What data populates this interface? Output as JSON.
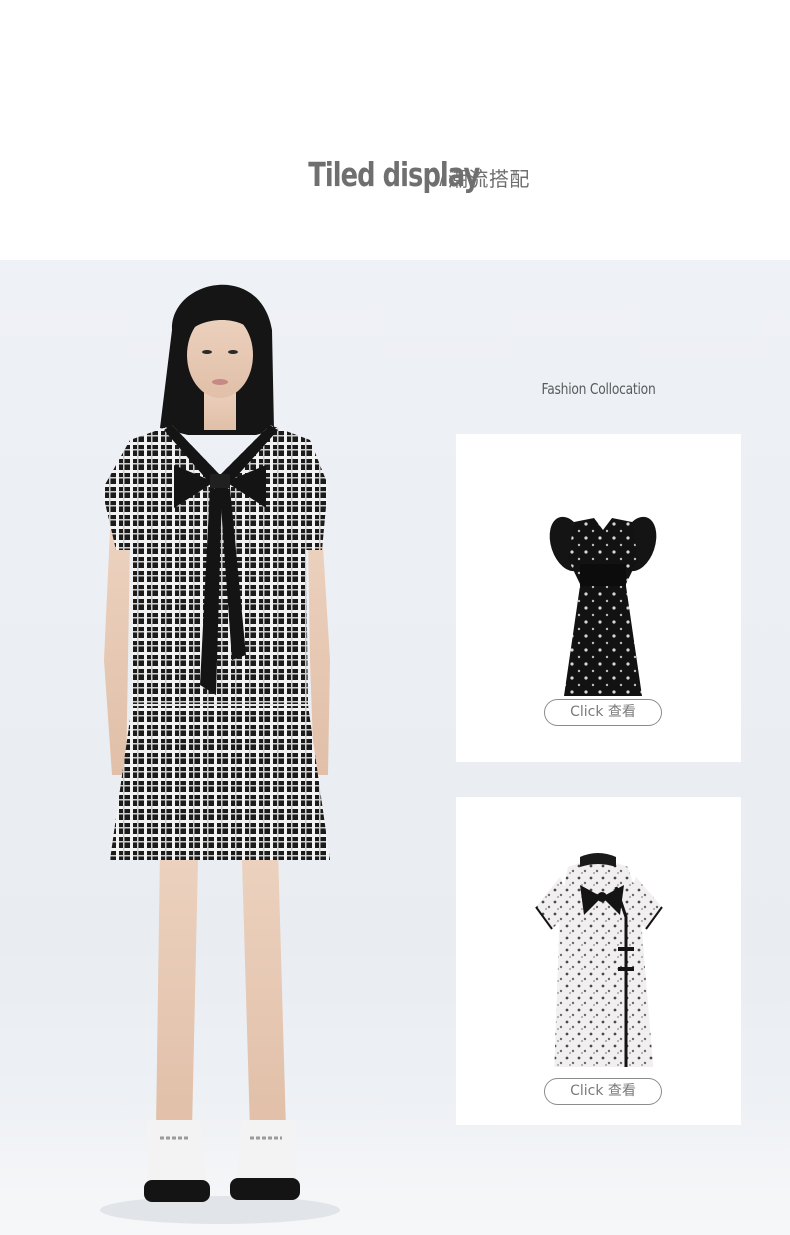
{
  "header": {
    "title_en": "Tiled display",
    "separator": "/",
    "title_cn": "潮流搭配"
  },
  "collocation": {
    "label": "Fashion Collocation",
    "items": [
      {
        "name": "black-floral-puff-sleeve-dress",
        "button_label": "Click 查看"
      },
      {
        "name": "white-floral-qipao-bow-dress",
        "button_label": "Click 查看"
      }
    ]
  },
  "colors": {
    "title": "#6f6f6f",
    "background": "#eef1f5",
    "card": "#ffffff",
    "button_border": "#8c8c8c"
  }
}
